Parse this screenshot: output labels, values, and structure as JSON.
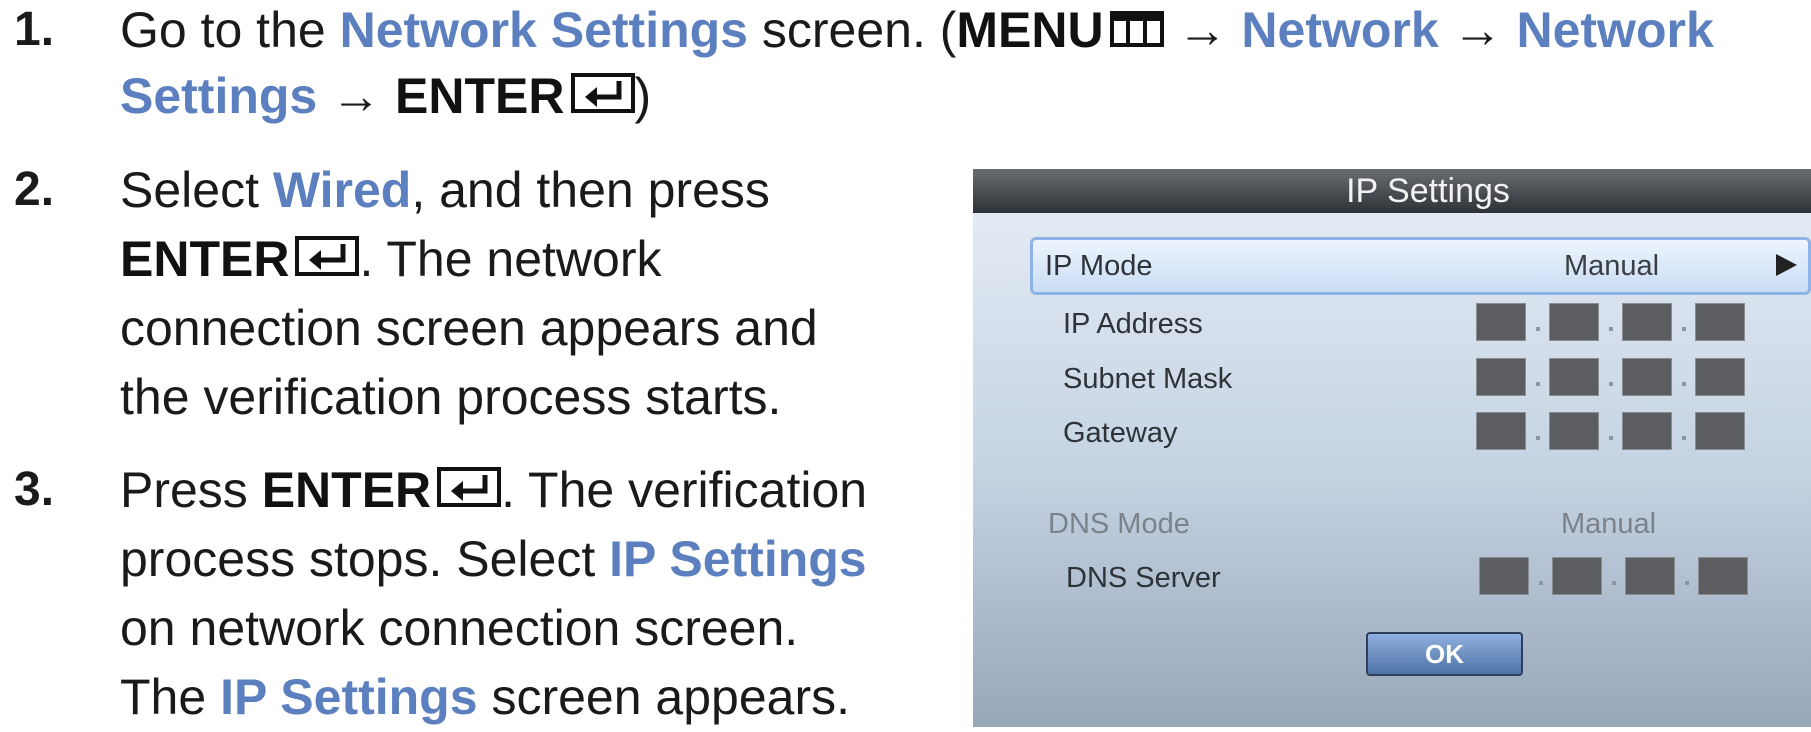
{
  "steps": [
    {
      "number": "1.",
      "lines": [
        {
          "t1": "Go to the ",
          "l1": "Network Settings",
          "t2": " screen. (",
          "b1": "MENU",
          "t3": " → ",
          "l2": "Network",
          "t4": " → ",
          "l3": "Network"
        },
        {
          "l1": "Settings",
          "t1": " → ",
          "b1": "ENTER",
          "t2": ")"
        }
      ]
    },
    {
      "number": "2.",
      "lines": [
        {
          "t1": "Select ",
          "l1": "Wired",
          "t2": ", and then press"
        },
        {
          "b1": "ENTER",
          "t1": ". The network"
        },
        {
          "t1": "connection screen appears and"
        },
        {
          "t1": "the verification process starts."
        }
      ]
    },
    {
      "number": "3.",
      "lines": [
        {
          "t1": "Press ",
          "b1": "ENTER",
          "t2": ". The verification"
        },
        {
          "t1": "process stops. Select ",
          "l1": "IP Settings"
        },
        {
          "t1": "on network connection screen."
        },
        {
          "t1": "The ",
          "l1": "IP Settings",
          "t2": " screen appears."
        }
      ]
    }
  ],
  "panel": {
    "title": "IP Settings",
    "ip_mode": {
      "label": "IP Mode",
      "value": "Manual"
    },
    "ip_address": {
      "label": "IP Address"
    },
    "subnet_mask": {
      "label": "Subnet Mask"
    },
    "gateway": {
      "label": "Gateway"
    },
    "dns_mode": {
      "label": "DNS Mode",
      "value": "Manual"
    },
    "dns_server": {
      "label": "DNS Server"
    },
    "ok_label": "OK"
  },
  "icons": {
    "menu": "menu-icon",
    "enter": "enter-icon",
    "arrow": "right-triangle-icon"
  }
}
